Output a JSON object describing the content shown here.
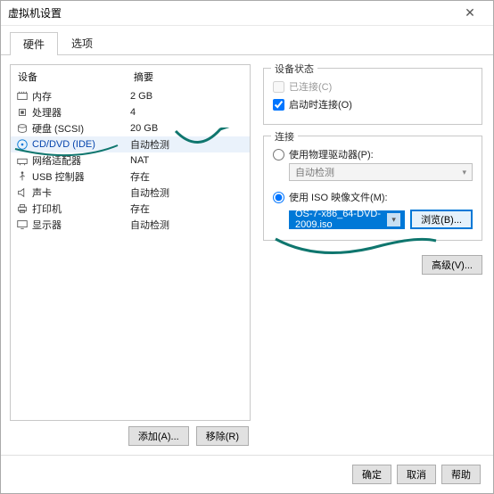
{
  "window": {
    "title": "虚拟机设置"
  },
  "tabs": {
    "hardware": "硬件",
    "options": "选项"
  },
  "cols": {
    "device": "设备",
    "summary": "摘要"
  },
  "hw": [
    {
      "name": "内存",
      "summary": "2 GB"
    },
    {
      "name": "处理器",
      "summary": "4"
    },
    {
      "name": "硬盘 (SCSI)",
      "summary": "20 GB"
    },
    {
      "name": "CD/DVD (IDE)",
      "summary": "自动检测"
    },
    {
      "name": "网络适配器",
      "summary": "NAT"
    },
    {
      "name": "USB 控制器",
      "summary": "存在"
    },
    {
      "name": "声卡",
      "summary": "自动检测"
    },
    {
      "name": "打印机",
      "summary": "存在"
    },
    {
      "name": "显示器",
      "summary": "自动检测"
    }
  ],
  "status": {
    "title": "设备状态",
    "connected": "已连接(C)",
    "connect_on": "启动时连接(O)"
  },
  "conn": {
    "title": "连接",
    "phys": "使用物理驱动器(P):",
    "phys_sel": "自动检测",
    "iso": "使用 ISO 映像文件(M):",
    "iso_val": "OS-7-x86_64-DVD-2009.iso",
    "browse": "浏览(B)..."
  },
  "adv": "高级(V)...",
  "bottom": {
    "add": "添加(A)...",
    "remove": "移除(R)"
  },
  "footer": {
    "ok": "确定",
    "cancel": "取消",
    "help": "帮助"
  }
}
